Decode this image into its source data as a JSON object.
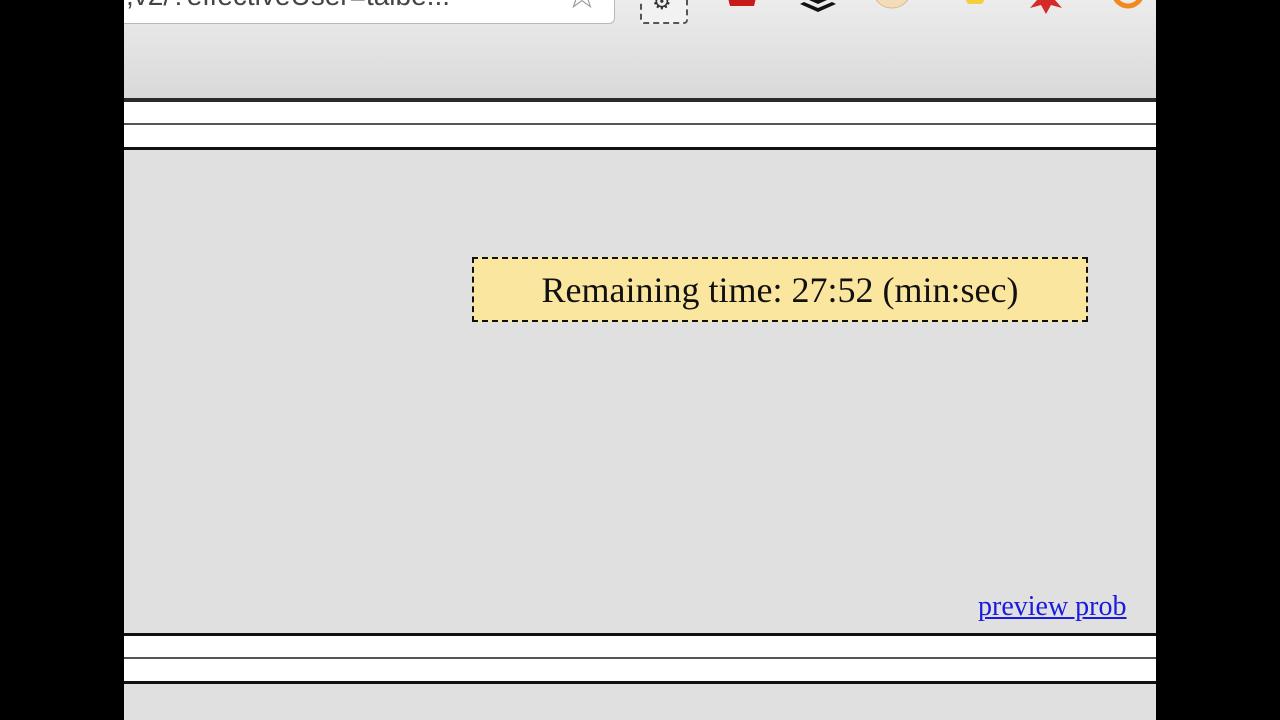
{
  "browser": {
    "url_fragment": ",v2/?effectiveUser=talbe...",
    "extensions": [
      "puzzle-extension-icon",
      "red-extension-icon",
      "layers-extension-icon",
      "face-extension-icon",
      "python-extension-icon",
      "red-star-extension-icon",
      "orange-extension-icon"
    ]
  },
  "timer": {
    "text": "Remaining time: 27:52 (min:sec)",
    "minutes": 27,
    "seconds": 52
  },
  "links": {
    "preview": "preview prob"
  },
  "colors": {
    "page_background": "#e0e0e0",
    "timer_background": "#fbe6a0",
    "link": "#1a1ae0"
  }
}
